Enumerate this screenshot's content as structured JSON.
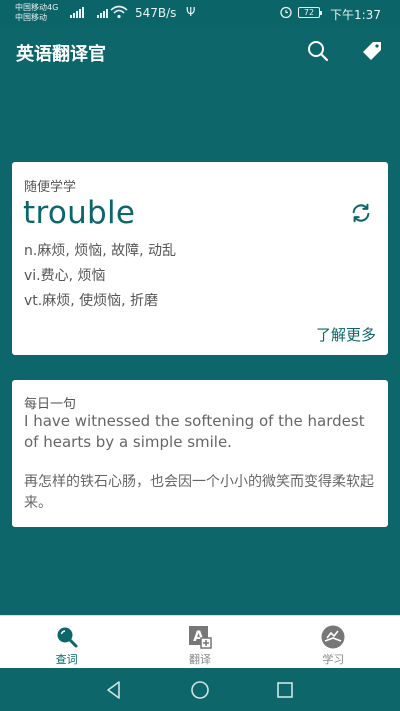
{
  "status_bar": {
    "carrier_line1": "中国移动4G",
    "carrier_line2": "中国移动",
    "network_speed": "547B/s",
    "usb_symbol": "Ψ",
    "battery": "72",
    "time": "下午1:37"
  },
  "app": {
    "title": "英语翻译官",
    "brand_color": "#0c666a"
  },
  "word_card": {
    "label": "随便学学",
    "word": "trouble",
    "meanings": [
      "n.麻烦, 烦恼, 故障, 动乱",
      "vi.费心, 烦恼",
      "vt.麻烦, 使烦恼, 折磨"
    ],
    "more_link": "了解更多"
  },
  "quote_card": {
    "label": "每日一句",
    "english": "I have witnessed the softening of the hardest of hearts by a simple smile.",
    "chinese": "再怎样的铁石心肠，也会因一个小小的微笑而变得柔软起来。"
  },
  "bottom_nav": {
    "items": [
      {
        "label": "查词",
        "icon": "search-icon",
        "active": true
      },
      {
        "label": "翻译",
        "icon": "translate-icon",
        "active": false
      },
      {
        "label": "学习",
        "icon": "study-icon",
        "active": false
      }
    ]
  },
  "system_nav": {
    "icons": [
      "back-icon",
      "home-icon",
      "recents-icon"
    ]
  }
}
